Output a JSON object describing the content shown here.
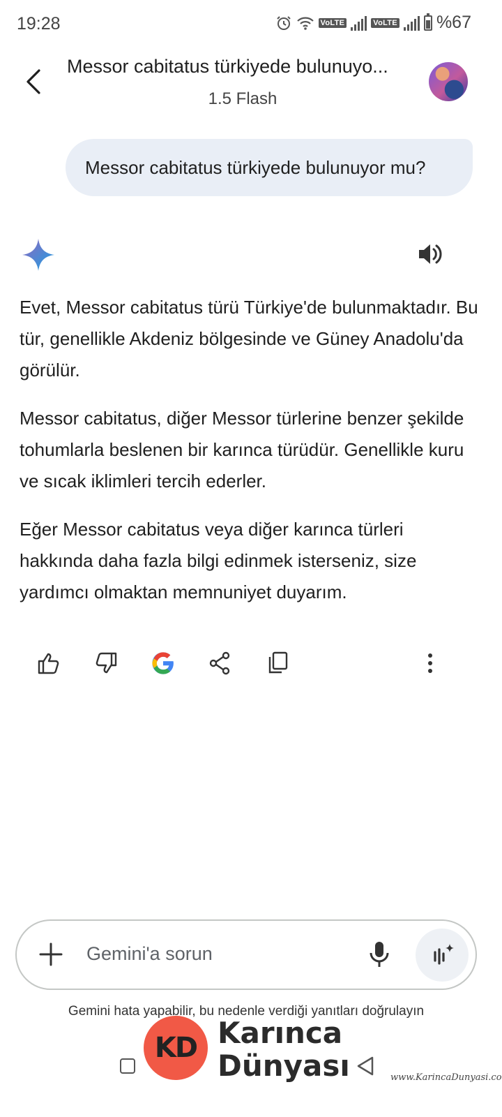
{
  "status_bar": {
    "time": "19:28",
    "volte1": "VoLTE",
    "volte2": "VoLTE",
    "battery": "%67",
    "icons": [
      "alarm-icon",
      "wifi-icon",
      "signal-icon",
      "battery-icon"
    ]
  },
  "header": {
    "title": "Messor cabitatus türkiyede bulunuyo...",
    "subtitle": "1.5 Flash"
  },
  "user_message": "Messor cabitatus türkiyede bulunuyor mu?",
  "response": {
    "paragraphs": [
      "Evet, Messor cabitatus türü Türkiye'de bulunmaktadır. Bu tür, genellikle Akdeniz bölgesinde ve Güney Anadolu'da görülür.",
      "Messor cabitatus, diğer Messor türlerine benzer şekilde tohumlarla beslenen bir karınca türüdür. Genellikle kuru ve sıcak iklimleri tercih ederler.",
      "Eğer Messor cabitatus veya diğer karınca türleri hakkında daha fazla bilgi edinmek isterseniz, size yardımcı olmaktan memnuniyet duyarım."
    ]
  },
  "input": {
    "placeholder": "Gemini'a sorun",
    "disclaimer": "Gemini hata yapabilir, bu nedenle verdiği yanıtları doğrulayın"
  },
  "watermark": {
    "logo_text": "KD",
    "line1": "Karınca",
    "line2": "Dünyası",
    "url": "www.KarincaDunyasi.com"
  },
  "colors": {
    "bubble": "#e9eef6",
    "accent_blue": "#4285f4",
    "watermark_red": "#f15946"
  }
}
